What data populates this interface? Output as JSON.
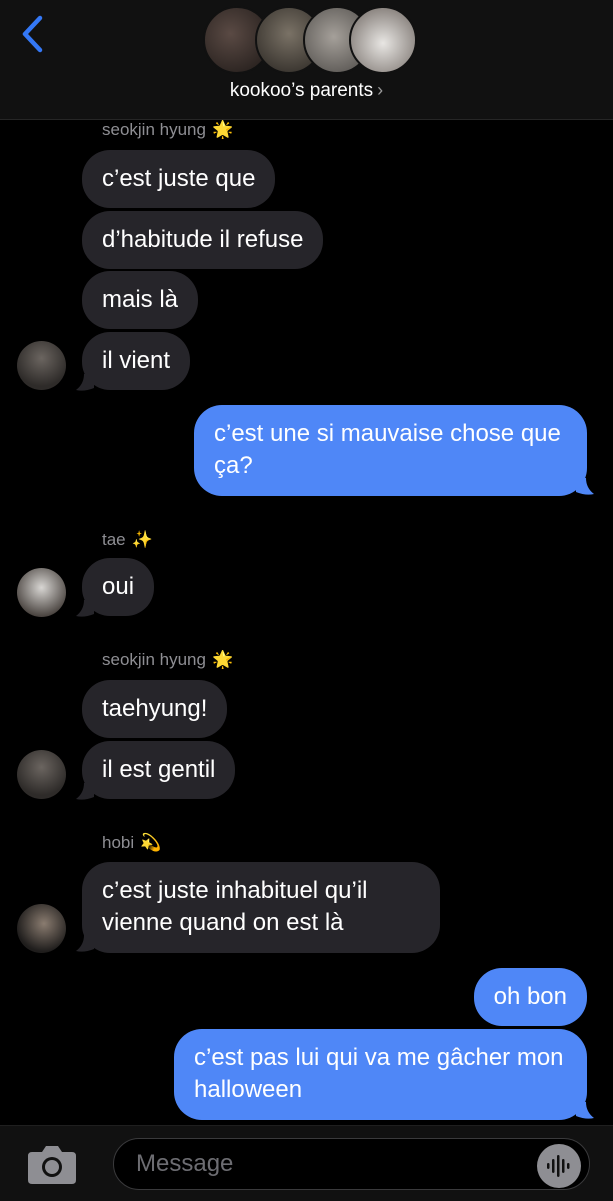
{
  "header": {
    "group_name": "kookoo’s parents",
    "chevron": "›"
  },
  "messages": {
    "sender_jin_1": "seokjin hyung",
    "sender_jin_1_emoji": "🌟",
    "m1": "c’est juste que",
    "m2": "d’habitude il refuse",
    "m3": "mais là",
    "m4": "il vient",
    "s1": "c’est une si mauvaise chose que ça?",
    "sender_tae": "tae",
    "sender_tae_emoji": "✨",
    "m5": "oui",
    "sender_jin_2": "seokjin hyung",
    "sender_jin_2_emoji": "🌟",
    "m6": "taehyung!",
    "m7": "il est gentil",
    "sender_hobi": "hobi",
    "sender_hobi_emoji": "💫",
    "m8": "c’est juste inhabituel qu’il vienne quand on est là",
    "s2": "oh bon",
    "s3": "c’est pas lui qui va me gâcher mon halloween"
  },
  "input": {
    "placeholder": "Message"
  },
  "colors": {
    "sent_bubble": "#4f87f7",
    "received_bubble": "#26252a",
    "background": "#000000",
    "accent": "#3478f6"
  },
  "icons": [
    "back-chevron-icon",
    "camera-icon",
    "voice-memo-icon"
  ]
}
